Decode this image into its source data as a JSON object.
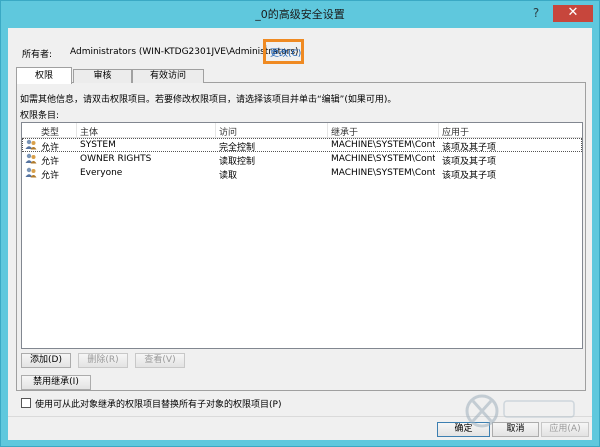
{
  "window": {
    "title": "_0的高级安全设置",
    "help_glyph": "?",
    "close_glyph": "✕"
  },
  "owner": {
    "label": "所有者:",
    "value": "Administrators (WIN-KTDG2301JVE\\Administrators)",
    "change_link": "更改(C)"
  },
  "tabs": [
    {
      "label": "权限",
      "active": true
    },
    {
      "label": "审核",
      "active": false
    },
    {
      "label": "有效访问",
      "active": false
    }
  ],
  "info_text": "如需其他信息，请双击权限项目。若要修改权限项目，请选择该项目并单击“编辑”(如果可用)。",
  "entries_label": "权限条目:",
  "list": {
    "headers": [
      "类型",
      "主体",
      "访问",
      "继承于",
      "应用于"
    ],
    "rows": [
      {
        "type": "允许",
        "principal": "SYSTEM",
        "access": "完全控制",
        "inherited_from": "MACHINE\\SYSTEM\\Contr...",
        "applies_to": "该项及其子项",
        "selected": true,
        "icon": "users-icon"
      },
      {
        "type": "允许",
        "principal": "OWNER RIGHTS",
        "access": "读取控制",
        "inherited_from": "MACHINE\\SYSTEM\\Contr...",
        "applies_to": "该项及其子项",
        "selected": false,
        "icon": "users-icon"
      },
      {
        "type": "允许",
        "principal": "Everyone",
        "access": "读取",
        "inherited_from": "MACHINE\\SYSTEM\\Contr...",
        "applies_to": "该项及其子项",
        "selected": false,
        "icon": "users-icon"
      }
    ]
  },
  "buttons": {
    "add": "添加(D)",
    "remove": "删除(R)",
    "view": "查看(V)",
    "disable_inheritance": "禁用继承(I)",
    "ok": "确定",
    "cancel": "取消",
    "apply": "应用(A)"
  },
  "checkbox": {
    "label": "使用可从此对象继承的权限项目替换所有子对象的权限项目(P)",
    "checked": false
  },
  "colors": {
    "titlebar": "#5fc8dd",
    "close_button": "#c7463c",
    "highlight_box": "#ef8a22",
    "link": "#1a5fb4"
  }
}
